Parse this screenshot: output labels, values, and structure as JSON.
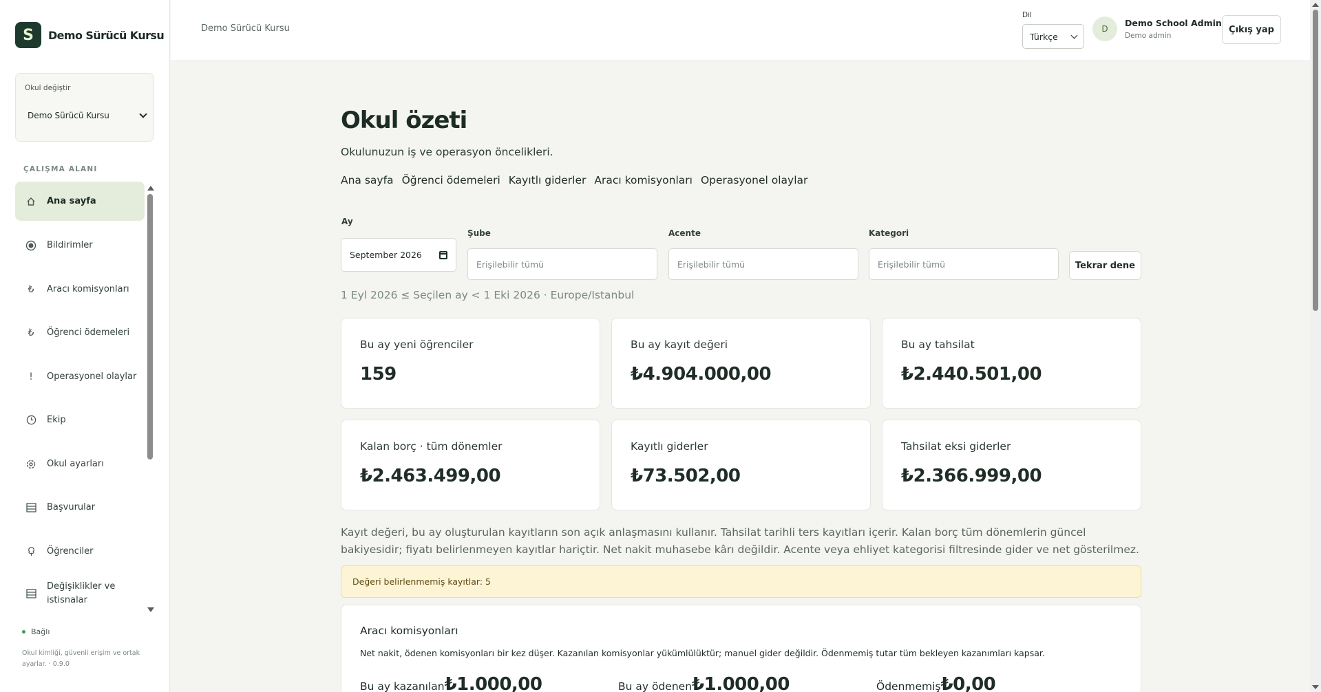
{
  "brand": {
    "logo_letter": "S",
    "name": "Demo Sürücü Kursu"
  },
  "school_switch": {
    "label": "Okul değiştir",
    "value": "Demo Sürücü Kursu"
  },
  "sidebar": {
    "section_label": "ÇALIŞMA ALANI",
    "items": [
      {
        "label": "Ana sayfa",
        "icon": "home-icon",
        "active": true
      },
      {
        "label": "Bildirimler",
        "icon": "bell-icon"
      },
      {
        "label": "Aracı komisyonları",
        "icon": "lira-icon"
      },
      {
        "label": "Öğrenci ödemeleri",
        "icon": "lira-icon"
      },
      {
        "label": "Operasyonel olaylar",
        "icon": "alert-icon"
      },
      {
        "label": "Ekip",
        "icon": "clock-icon"
      },
      {
        "label": "Okul ayarları",
        "icon": "gear-icon"
      },
      {
        "label": "Başvurular",
        "icon": "list-icon"
      },
      {
        "label": "Öğrenciler",
        "icon": "tree-icon"
      },
      {
        "label": "Değişiklikler ve istisnalar",
        "icon": "list-icon"
      }
    ],
    "status": "Bağlı",
    "footnote": "Okul kimliği, güvenli erişim ve ortak ayarlar. · 0.9.0"
  },
  "topbar": {
    "breadcrumb": "Demo Sürücü Kursu",
    "language_label": "Dil",
    "language_value": "Türkçe",
    "avatar_initial": "D",
    "user_name": "Demo School Admin",
    "user_role": "Demo admin",
    "logout_label": "Çıkış yap"
  },
  "main": {
    "title": "Okul özeti",
    "subtitle": "Okulunuzun iş ve operasyon öncelikleri.",
    "tabs": [
      "Ana sayfa",
      "Öğrenci ödemeleri",
      "Kayıtlı giderler",
      "Aracı komisyonları",
      "Operasyonel olaylar"
    ],
    "filters": {
      "month_label": "Ay",
      "month_value": "September 2026",
      "branch_label": "Şube",
      "branch_placeholder": "Erişilebilir tümü",
      "agency_label": "Acente",
      "agency_placeholder": "Erişilebilir tümü",
      "category_label": "Kategori",
      "category_placeholder": "Erişilebilir tümü",
      "retry_label": "Tekrar dene"
    },
    "range_text": "1 Eyl 2026 ≤ Seçilen ay < 1 Eki 2026 · Europe/Istanbul",
    "cards": [
      {
        "label": "Bu ay yeni öğrenciler",
        "value": "159"
      },
      {
        "label": "Bu ay kayıt değeri",
        "value": "₺4.904.000,00"
      },
      {
        "label": "Bu ay tahsilat",
        "value": "₺2.440.501,00"
      },
      {
        "label": "Kalan borç · tüm dönemler",
        "value": "₺2.463.499,00"
      },
      {
        "label": "Kayıtlı giderler",
        "value": "₺73.502,00"
      },
      {
        "label": "Tahsilat eksi giderler",
        "value": "₺2.366.999,00"
      }
    ],
    "note": "Kayıt değeri, bu ay oluşturulan kayıtların son açık anlaşmasını kullanır. Tahsilat tarihli ters kayıtları içerir. Kalan borç tüm dönemlerin güncel bakiyesidir; fiyatı belirlenmeyen kayıtlar hariçtir. Net nakit muhasebe kârı değildir. Acente veya ehliyet kategorisi filtresinde gider ve net gösterilmez.",
    "warning": "Değeri belirlenmemiş kayıtlar: 5",
    "commission": {
      "title": "Aracı komisyonları",
      "description": "Net nakit, ödenen komisyonları bir kez düşer. Kazanılan komisyonlar yükümlülüktür; manuel gider değildir. Ödenmemiş tutar tüm bekleyen kazanımları kapsar.",
      "metrics": [
        {
          "label": "Bu ay kazanılan",
          "value": "₺1.000,00"
        },
        {
          "label": "Bu ay ödenen",
          "value": "₺1.000,00"
        },
        {
          "label": "Ödenmemiş",
          "value": "₺0,00"
        }
      ]
    }
  },
  "colors": {
    "brand": "#1e3a2f",
    "active_nav": "#e4ecdc",
    "warning_bg": "#fdf4d6"
  }
}
